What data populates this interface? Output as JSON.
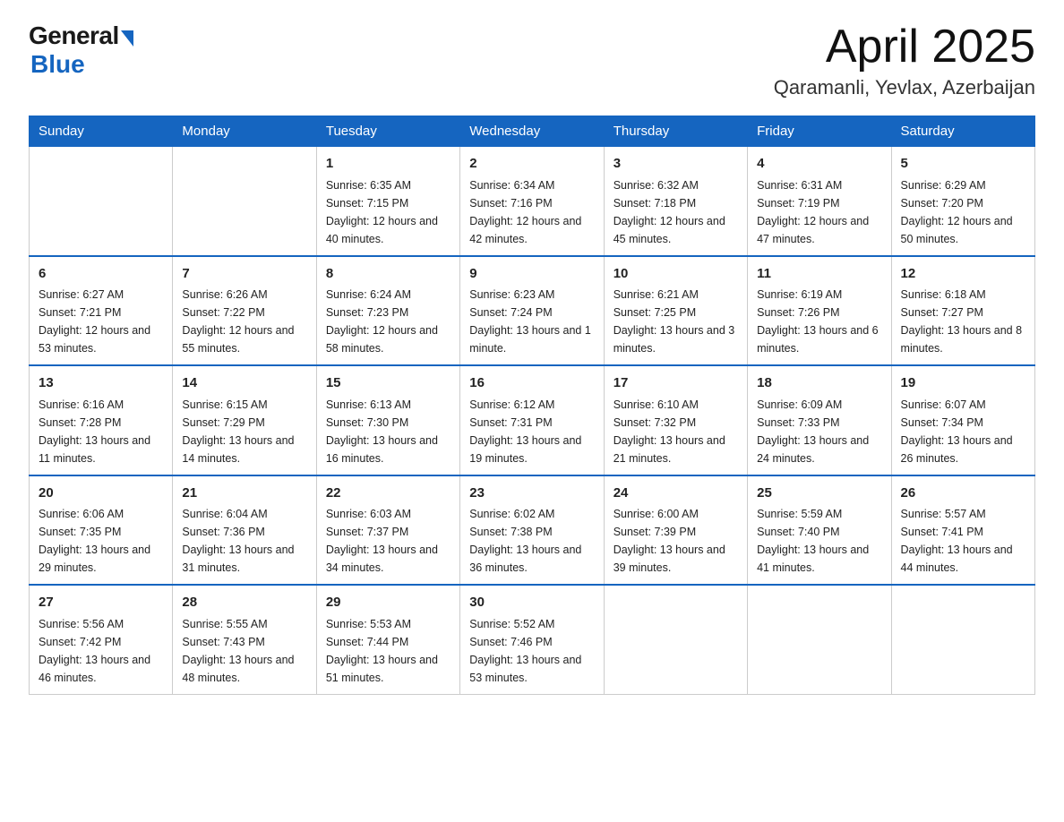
{
  "header": {
    "logo_general": "General",
    "logo_blue": "Blue",
    "month": "April 2025",
    "location": "Qaramanli, Yevlax, Azerbaijan"
  },
  "weekdays": [
    "Sunday",
    "Monday",
    "Tuesday",
    "Wednesday",
    "Thursday",
    "Friday",
    "Saturday"
  ],
  "weeks": [
    [
      {
        "day": "",
        "sunrise": "",
        "sunset": "",
        "daylight": ""
      },
      {
        "day": "",
        "sunrise": "",
        "sunset": "",
        "daylight": ""
      },
      {
        "day": "1",
        "sunrise": "Sunrise: 6:35 AM",
        "sunset": "Sunset: 7:15 PM",
        "daylight": "Daylight: 12 hours and 40 minutes."
      },
      {
        "day": "2",
        "sunrise": "Sunrise: 6:34 AM",
        "sunset": "Sunset: 7:16 PM",
        "daylight": "Daylight: 12 hours and 42 minutes."
      },
      {
        "day": "3",
        "sunrise": "Sunrise: 6:32 AM",
        "sunset": "Sunset: 7:18 PM",
        "daylight": "Daylight: 12 hours and 45 minutes."
      },
      {
        "day": "4",
        "sunrise": "Sunrise: 6:31 AM",
        "sunset": "Sunset: 7:19 PM",
        "daylight": "Daylight: 12 hours and 47 minutes."
      },
      {
        "day": "5",
        "sunrise": "Sunrise: 6:29 AM",
        "sunset": "Sunset: 7:20 PM",
        "daylight": "Daylight: 12 hours and 50 minutes."
      }
    ],
    [
      {
        "day": "6",
        "sunrise": "Sunrise: 6:27 AM",
        "sunset": "Sunset: 7:21 PM",
        "daylight": "Daylight: 12 hours and 53 minutes."
      },
      {
        "day": "7",
        "sunrise": "Sunrise: 6:26 AM",
        "sunset": "Sunset: 7:22 PM",
        "daylight": "Daylight: 12 hours and 55 minutes."
      },
      {
        "day": "8",
        "sunrise": "Sunrise: 6:24 AM",
        "sunset": "Sunset: 7:23 PM",
        "daylight": "Daylight: 12 hours and 58 minutes."
      },
      {
        "day": "9",
        "sunrise": "Sunrise: 6:23 AM",
        "sunset": "Sunset: 7:24 PM",
        "daylight": "Daylight: 13 hours and 1 minute."
      },
      {
        "day": "10",
        "sunrise": "Sunrise: 6:21 AM",
        "sunset": "Sunset: 7:25 PM",
        "daylight": "Daylight: 13 hours and 3 minutes."
      },
      {
        "day": "11",
        "sunrise": "Sunrise: 6:19 AM",
        "sunset": "Sunset: 7:26 PM",
        "daylight": "Daylight: 13 hours and 6 minutes."
      },
      {
        "day": "12",
        "sunrise": "Sunrise: 6:18 AM",
        "sunset": "Sunset: 7:27 PM",
        "daylight": "Daylight: 13 hours and 8 minutes."
      }
    ],
    [
      {
        "day": "13",
        "sunrise": "Sunrise: 6:16 AM",
        "sunset": "Sunset: 7:28 PM",
        "daylight": "Daylight: 13 hours and 11 minutes."
      },
      {
        "day": "14",
        "sunrise": "Sunrise: 6:15 AM",
        "sunset": "Sunset: 7:29 PM",
        "daylight": "Daylight: 13 hours and 14 minutes."
      },
      {
        "day": "15",
        "sunrise": "Sunrise: 6:13 AM",
        "sunset": "Sunset: 7:30 PM",
        "daylight": "Daylight: 13 hours and 16 minutes."
      },
      {
        "day": "16",
        "sunrise": "Sunrise: 6:12 AM",
        "sunset": "Sunset: 7:31 PM",
        "daylight": "Daylight: 13 hours and 19 minutes."
      },
      {
        "day": "17",
        "sunrise": "Sunrise: 6:10 AM",
        "sunset": "Sunset: 7:32 PM",
        "daylight": "Daylight: 13 hours and 21 minutes."
      },
      {
        "day": "18",
        "sunrise": "Sunrise: 6:09 AM",
        "sunset": "Sunset: 7:33 PM",
        "daylight": "Daylight: 13 hours and 24 minutes."
      },
      {
        "day": "19",
        "sunrise": "Sunrise: 6:07 AM",
        "sunset": "Sunset: 7:34 PM",
        "daylight": "Daylight: 13 hours and 26 minutes."
      }
    ],
    [
      {
        "day": "20",
        "sunrise": "Sunrise: 6:06 AM",
        "sunset": "Sunset: 7:35 PM",
        "daylight": "Daylight: 13 hours and 29 minutes."
      },
      {
        "day": "21",
        "sunrise": "Sunrise: 6:04 AM",
        "sunset": "Sunset: 7:36 PM",
        "daylight": "Daylight: 13 hours and 31 minutes."
      },
      {
        "day": "22",
        "sunrise": "Sunrise: 6:03 AM",
        "sunset": "Sunset: 7:37 PM",
        "daylight": "Daylight: 13 hours and 34 minutes."
      },
      {
        "day": "23",
        "sunrise": "Sunrise: 6:02 AM",
        "sunset": "Sunset: 7:38 PM",
        "daylight": "Daylight: 13 hours and 36 minutes."
      },
      {
        "day": "24",
        "sunrise": "Sunrise: 6:00 AM",
        "sunset": "Sunset: 7:39 PM",
        "daylight": "Daylight: 13 hours and 39 minutes."
      },
      {
        "day": "25",
        "sunrise": "Sunrise: 5:59 AM",
        "sunset": "Sunset: 7:40 PM",
        "daylight": "Daylight: 13 hours and 41 minutes."
      },
      {
        "day": "26",
        "sunrise": "Sunrise: 5:57 AM",
        "sunset": "Sunset: 7:41 PM",
        "daylight": "Daylight: 13 hours and 44 minutes."
      }
    ],
    [
      {
        "day": "27",
        "sunrise": "Sunrise: 5:56 AM",
        "sunset": "Sunset: 7:42 PM",
        "daylight": "Daylight: 13 hours and 46 minutes."
      },
      {
        "day": "28",
        "sunrise": "Sunrise: 5:55 AM",
        "sunset": "Sunset: 7:43 PM",
        "daylight": "Daylight: 13 hours and 48 minutes."
      },
      {
        "day": "29",
        "sunrise": "Sunrise: 5:53 AM",
        "sunset": "Sunset: 7:44 PM",
        "daylight": "Daylight: 13 hours and 51 minutes."
      },
      {
        "day": "30",
        "sunrise": "Sunrise: 5:52 AM",
        "sunset": "Sunset: 7:46 PM",
        "daylight": "Daylight: 13 hours and 53 minutes."
      },
      {
        "day": "",
        "sunrise": "",
        "sunset": "",
        "daylight": ""
      },
      {
        "day": "",
        "sunrise": "",
        "sunset": "",
        "daylight": ""
      },
      {
        "day": "",
        "sunrise": "",
        "sunset": "",
        "daylight": ""
      }
    ]
  ]
}
